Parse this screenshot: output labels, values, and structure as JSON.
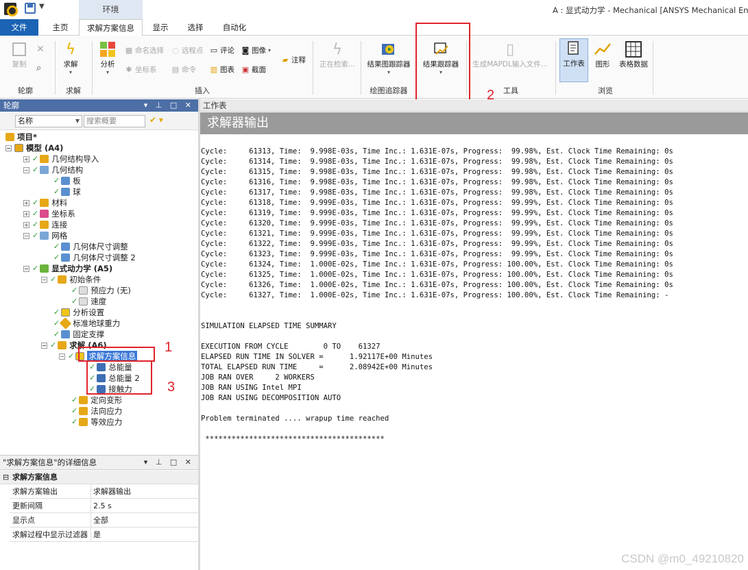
{
  "window": {
    "title": "A : 显式动力学 - Mechanical [ANSYS Mechanical Enterp"
  },
  "context_tab": "环境",
  "tabs": {
    "file": "文件",
    "home": "主页",
    "solution_info": "求解方案信息",
    "display": "显示",
    "select": "选择",
    "automation": "自动化"
  },
  "ribbon": {
    "copy": "复制",
    "outline_group": "轮廓",
    "solve": "求解",
    "solve_group": "求解",
    "analysis": "分析",
    "named_select": "命名选择",
    "coordinate_sys": "坐标系",
    "remote_point": "远程点",
    "command": "命令",
    "comment": "评论",
    "chart": "图表",
    "image": "图像",
    "screenshot": "截面",
    "annotation": "注释",
    "insert_group": "插入",
    "checking": "正在检索...",
    "result_plot_tracker": "结果图跟踪器",
    "result_tracker": "结果跟踪器",
    "plot_tracker_group": "绘图追踪器",
    "gen_mapdl": "生成MAPDL输入文件...",
    "tools_group": "工具",
    "worksheet": "工作表",
    "graph": "图形",
    "tabular": "表格数据",
    "browse_group": "浏览"
  },
  "annotations": {
    "one": "1",
    "two": "2",
    "three": "3"
  },
  "outline": {
    "title": "轮廓",
    "name_filter": "名称",
    "search_placeholder": "搜索概要",
    "tree": [
      "项目*",
      "模型 (A4)",
      "几何结构导入",
      "几何结构",
      "板",
      "球",
      "材料",
      "坐标系",
      "连接",
      "网格",
      "几何体尺寸调整",
      "几何体尺寸调整 2",
      "显式动力学 (A5)",
      "初始条件",
      "预应力 (无)",
      "速度",
      "分析设置",
      "标准地球重力",
      "固定支撑",
      "求解 (A6)",
      "求解方案信息",
      "总能量",
      "总能量 2",
      "接触力",
      "定向变形",
      "法向应力",
      "等效应力"
    ]
  },
  "details": {
    "title": "\"求解方案信息\"的详细信息",
    "section": "求解方案信息",
    "rows": [
      {
        "k": "求解方案输出",
        "v": "求解器输出"
      },
      {
        "k": "更新间隔",
        "v": "2.5 s"
      },
      {
        "k": "显示点",
        "v": "全部"
      },
      {
        "k": "求解过程中显示过滤器",
        "v": "是"
      }
    ]
  },
  "worksheet": {
    "header": "工作表",
    "title": "求解器输出",
    "lines": [
      "Cycle:     61313, Time:  9.998E-03s, Time Inc.: 1.631E-07s, Progress:  99.98%, Est. Clock Time Remaining: 0s",
      "Cycle:     61314, Time:  9.998E-03s, Time Inc.: 1.631E-07s, Progress:  99.98%, Est. Clock Time Remaining: 0s",
      "Cycle:     61315, Time:  9.998E-03s, Time Inc.: 1.631E-07s, Progress:  99.98%, Est. Clock Time Remaining: 0s",
      "Cycle:     61316, Time:  9.998E-03s, Time Inc.: 1.631E-07s, Progress:  99.98%, Est. Clock Time Remaining: 0s",
      "Cycle:     61317, Time:  9.998E-03s, Time Inc.: 1.631E-07s, Progress:  99.98%, Est. Clock Time Remaining: 0s",
      "Cycle:     61318, Time:  9.999E-03s, Time Inc.: 1.631E-07s, Progress:  99.99%, Est. Clock Time Remaining: 0s",
      "Cycle:     61319, Time:  9.999E-03s, Time Inc.: 1.631E-07s, Progress:  99.99%, Est. Clock Time Remaining: 0s",
      "Cycle:     61320, Time:  9.999E-03s, Time Inc.: 1.631E-07s, Progress:  99.99%, Est. Clock Time Remaining: 0s",
      "Cycle:     61321, Time:  9.999E-03s, Time Inc.: 1.631E-07s, Progress:  99.99%, Est. Clock Time Remaining: 0s",
      "Cycle:     61322, Time:  9.999E-03s, Time Inc.: 1.631E-07s, Progress:  99.99%, Est. Clock Time Remaining: 0s",
      "Cycle:     61323, Time:  9.999E-03s, Time Inc.: 1.631E-07s, Progress:  99.99%, Est. Clock Time Remaining: 0s",
      "Cycle:     61324, Time:  1.000E-02s, Time Inc.: 1.631E-07s, Progress: 100.00%, Est. Clock Time Remaining: 0s",
      "Cycle:     61325, Time:  1.000E-02s, Time Inc.: 1.631E-07s, Progress: 100.00%, Est. Clock Time Remaining: 0s",
      "Cycle:     61326, Time:  1.000E-02s, Time Inc.: 1.631E-07s, Progress: 100.00%, Est. Clock Time Remaining: 0s",
      "Cycle:     61327, Time:  1.000E-02s, Time Inc.: 1.631E-07s, Progress: 100.00%, Est. Clock Time Remaining: -",
      "",
      "",
      "SIMULATION ELAPSED TIME SUMMARY",
      "",
      "EXECUTION FROM CYCLE        0 TO    61327",
      "ELAPSED RUN TIME IN SOLVER =      1.92117E+00 Minutes",
      "TOTAL ELAPSED RUN TIME     =      2.08942E+00 Minutes",
      "JOB RAN OVER     2 WORKERS",
      "JOB RAN USING Intel MPI",
      "JOB RAN USING DECOMPOSITION AUTO",
      "",
      "Problem terminated .... wrapup time reached",
      "",
      " *****************************************"
    ]
  },
  "watermark": "CSDN @m0_49210820",
  "colors": {
    "accent": "#1b63b4",
    "highlight_box": "#e0232b",
    "outline_header": "#4d6fa6",
    "selection": "#3c78d8",
    "check": "#2a9b3a"
  }
}
